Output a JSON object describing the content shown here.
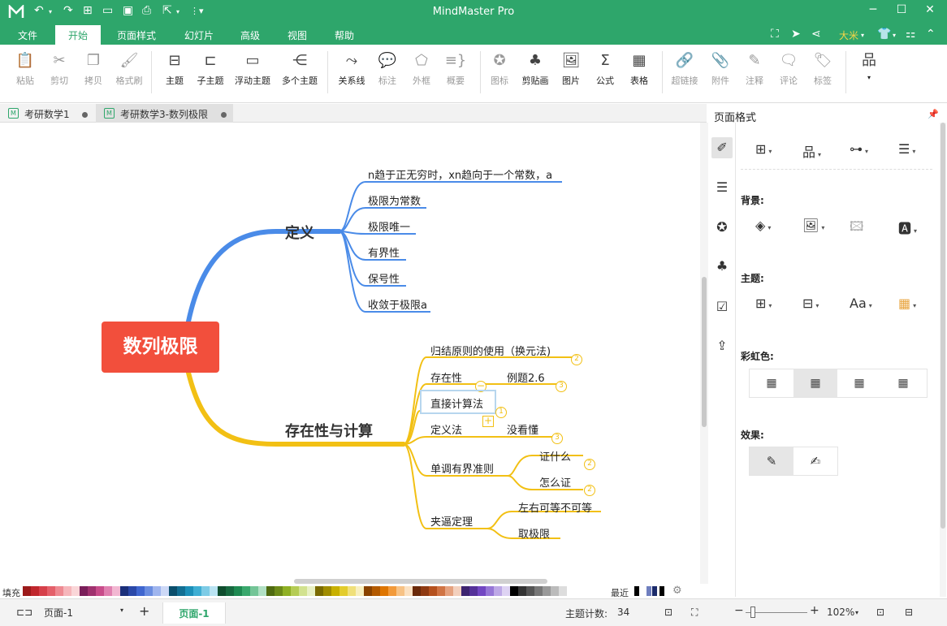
{
  "app": {
    "title": "MindMaster Pro",
    "accent_color": "#2ea66b"
  },
  "window": {
    "minimize": "─",
    "maximize": "☐",
    "close": "✕"
  },
  "menu": {
    "items": [
      "文件",
      "开始",
      "页面样式",
      "幻灯片",
      "高级",
      "视图",
      "帮助"
    ],
    "active": "开始",
    "user": "大米"
  },
  "ribbon": {
    "groups": [
      [
        {
          "label": "粘贴",
          "icon": "paste-icon",
          "enabled": false
        },
        {
          "label": "剪切",
          "icon": "scissors-icon",
          "enabled": false
        },
        {
          "label": "拷贝",
          "icon": "copy-icon",
          "enabled": false
        },
        {
          "label": "格式刷",
          "icon": "format-brush-icon",
          "enabled": false
        }
      ],
      [
        {
          "label": "主题",
          "icon": "topic-icon",
          "enabled": true
        },
        {
          "label": "子主题",
          "icon": "subtopic-icon",
          "enabled": true
        },
        {
          "label": "浮动主题",
          "icon": "floating-topic-icon",
          "enabled": true
        },
        {
          "label": "多个主题",
          "icon": "multiple-topics-icon",
          "enabled": true
        }
      ],
      [
        {
          "label": "关系线",
          "icon": "relationship-icon",
          "enabled": true
        },
        {
          "label": "标注",
          "icon": "callout-icon",
          "enabled": false
        },
        {
          "label": "外框",
          "icon": "boundary-icon",
          "enabled": false
        },
        {
          "label": "概要",
          "icon": "summary-icon",
          "enabled": false
        }
      ],
      [
        {
          "label": "图标",
          "icon": "mark-icon",
          "enabled": false
        },
        {
          "label": "剪贴画",
          "icon": "clipart-icon",
          "enabled": true
        },
        {
          "label": "图片",
          "icon": "picture-icon",
          "enabled": true
        },
        {
          "label": "公式",
          "icon": "formula-icon",
          "enabled": true
        },
        {
          "label": "表格",
          "icon": "table-icon",
          "enabled": true
        }
      ],
      [
        {
          "label": "超链接",
          "icon": "hyperlink-icon",
          "enabled": false
        },
        {
          "label": "附件",
          "icon": "attachment-icon",
          "enabled": false
        },
        {
          "label": "注释",
          "icon": "note-icon",
          "enabled": false
        },
        {
          "label": "评论",
          "icon": "comment-icon",
          "enabled": false
        },
        {
          "label": "标签",
          "icon": "tag-icon",
          "enabled": false
        }
      ]
    ]
  },
  "doc_tabs": [
    {
      "label": "考研数学1",
      "active": false
    },
    {
      "label": "考研数学3-数列极限",
      "active": true
    }
  ],
  "mindmap": {
    "central": "数列极限",
    "central_color": "#f24f3c",
    "branches": [
      {
        "title": "定义",
        "color": "#4a8be8",
        "children": [
          "n趋于正无穷时，xn趋向于一个常数，a",
          "极限为常数",
          "极限唯一",
          "有界性",
          "保号性",
          "收敛于极限a"
        ]
      },
      {
        "title": "存在性与计算",
        "color": "#f2c014",
        "children": [
          {
            "label": "归结原则的使用（换元法)",
            "badge": "2"
          },
          {
            "label": "存在性",
            "children": [
              "例题2.6"
            ],
            "badge": "3"
          },
          {
            "label": "直接计算法",
            "badge": "1"
          },
          {
            "label": "定义法",
            "children": [
              "没看懂"
            ],
            "badge": "3"
          },
          {
            "label": "单调有界准则",
            "children": [
              "证什么",
              "怎么证"
            ],
            "child_badges": [
              "2",
              "2"
            ]
          },
          {
            "label": "夹逼定理",
            "children": [
              "左右可等不可等",
              "取极限"
            ]
          }
        ]
      }
    ]
  },
  "panel": {
    "title": "页面格式",
    "sections": {
      "background": "背景:",
      "theme": "主题:",
      "rainbow": "彩虹色:",
      "effect": "效果:"
    }
  },
  "colorbar": {
    "fill_label": "填充",
    "recent_label": "最近"
  },
  "status": {
    "page_select": "页面-1",
    "page_tab": "页面-1",
    "topic_count_label": "主题计数:",
    "topic_count": "34",
    "zoom": "102%"
  }
}
